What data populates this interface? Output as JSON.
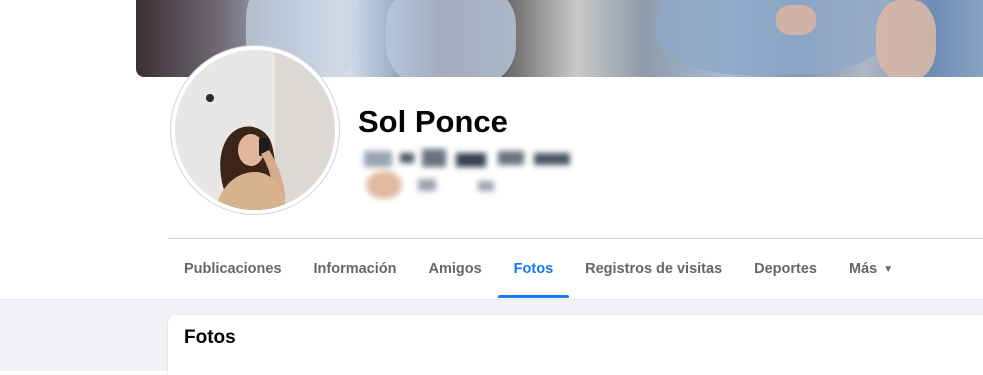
{
  "profile": {
    "name": "Sol Ponce"
  },
  "tabs": [
    {
      "label": "Publicaciones"
    },
    {
      "label": "Información"
    },
    {
      "label": "Amigos"
    },
    {
      "label": "Fotos",
      "active": true
    },
    {
      "label": "Registros de visitas"
    },
    {
      "label": "Deportes"
    },
    {
      "label": "Más"
    }
  ],
  "section": {
    "title": "Fotos"
  },
  "colors": {
    "accent": "#1877f2",
    "tab_text": "#65676b",
    "page_background": "#f0f2f5"
  },
  "icons": {
    "more_dropdown": "caret-down-icon"
  }
}
